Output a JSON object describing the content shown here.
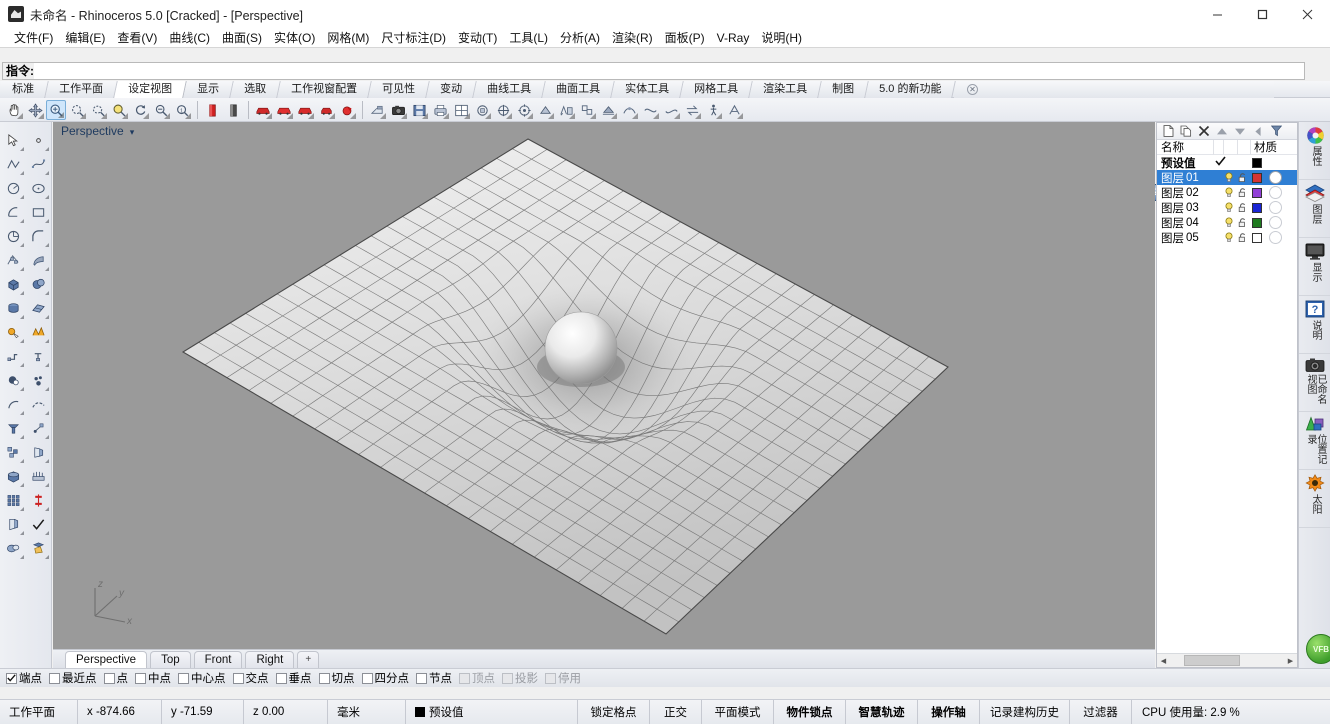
{
  "window": {
    "title": "未命名 - Rhinoceros 5.0 [Cracked] - [Perspective]",
    "app_icon": "rhino-icon",
    "controls": {
      "minimize": "minimize-icon",
      "maximize": "maximize-icon",
      "close": "close-icon"
    }
  },
  "menubar": [
    {
      "label": "文件(F)"
    },
    {
      "label": "编辑(E)"
    },
    {
      "label": "查看(V)"
    },
    {
      "label": "曲线(C)"
    },
    {
      "label": "曲面(S)"
    },
    {
      "label": "实体(O)"
    },
    {
      "label": "网格(M)"
    },
    {
      "label": "尺寸标注(D)"
    },
    {
      "label": "变动(T)"
    },
    {
      "label": "工具(L)"
    },
    {
      "label": "分析(A)"
    },
    {
      "label": "渲染(R)"
    },
    {
      "label": "面板(P)"
    },
    {
      "label": "V-Ray"
    },
    {
      "label": "说明(H)"
    }
  ],
  "command": {
    "prompt": "指令:",
    "value": "",
    "placeholder": ""
  },
  "toolbar_tabs": [
    {
      "label": "标准",
      "active": false
    },
    {
      "label": "工作平面",
      "active": false
    },
    {
      "label": "设定视图",
      "active": true
    },
    {
      "label": "显示",
      "active": false
    },
    {
      "label": "选取",
      "active": false
    },
    {
      "label": "工作视窗配置",
      "active": false
    },
    {
      "label": "可见性",
      "active": false
    },
    {
      "label": "变动",
      "active": false
    },
    {
      "label": "曲线工具",
      "active": false
    },
    {
      "label": "曲面工具",
      "active": false
    },
    {
      "label": "实体工具",
      "active": false
    },
    {
      "label": "网格工具",
      "active": false
    },
    {
      "label": "渲染工具",
      "active": false
    },
    {
      "label": "制图",
      "active": false
    },
    {
      "label": "5.0 的新功能",
      "active": false
    }
  ],
  "viewport": {
    "name": "Perspective",
    "axes": {
      "x": "x",
      "y": "y",
      "z": "z"
    },
    "background_color": "#9a9a9a",
    "tabs": [
      {
        "label": "Perspective",
        "active": true
      },
      {
        "label": "Top",
        "active": false
      },
      {
        "label": "Front",
        "active": false
      },
      {
        "label": "Right",
        "active": false
      },
      {
        "label": "+",
        "active": false
      }
    ]
  },
  "layers_panel": {
    "toolbar_icons": [
      "new-layer-icon",
      "copy-layer-icon",
      "delete-layer-icon",
      "move-up-icon",
      "move-down-icon",
      "back-arrow-icon",
      "filter-icon"
    ],
    "columns": {
      "name": "名称",
      "material": "材质"
    },
    "rows": [
      {
        "name": "预设值",
        "sub": "",
        "current": true,
        "selected": false,
        "color": "#000000",
        "bulb": false,
        "lock": false,
        "material": false
      },
      {
        "name": "图层",
        "sub": "01",
        "current": false,
        "selected": true,
        "color": "#d53434",
        "bulb": true,
        "lock": true,
        "material": true
      },
      {
        "name": "图层",
        "sub": "02",
        "current": false,
        "selected": false,
        "color": "#9140d6",
        "bulb": true,
        "lock": true,
        "material": false
      },
      {
        "name": "图层",
        "sub": "03",
        "current": false,
        "selected": false,
        "color": "#1a25d4",
        "bulb": true,
        "lock": true,
        "material": false
      },
      {
        "name": "图层",
        "sub": "04",
        "current": false,
        "selected": false,
        "color": "#1f7a1f",
        "bulb": true,
        "lock": true,
        "material": false
      },
      {
        "name": "图层",
        "sub": "05",
        "current": false,
        "selected": false,
        "color": "#ffffff",
        "bulb": true,
        "lock": true,
        "material": false
      }
    ]
  },
  "sidebar_tabs": [
    {
      "label": "属性",
      "icon": "color-wheel-icon"
    },
    {
      "label": "图层",
      "icon": "layers-icon"
    },
    {
      "label": "显示",
      "icon": "monitor-icon"
    },
    {
      "label": "说明",
      "icon": "help-icon"
    },
    {
      "label": "已命名视图",
      "icon": "camera-icon"
    },
    {
      "label": "位置记录",
      "icon": "position-icon"
    },
    {
      "label": "太阳",
      "icon": "sun-icon"
    }
  ],
  "osnap": [
    {
      "label": "端点",
      "checked": true,
      "enabled": true
    },
    {
      "label": "最近点",
      "checked": false,
      "enabled": true
    },
    {
      "label": "点",
      "checked": false,
      "enabled": true
    },
    {
      "label": "中点",
      "checked": false,
      "enabled": true
    },
    {
      "label": "中心点",
      "checked": false,
      "enabled": true
    },
    {
      "label": "交点",
      "checked": false,
      "enabled": true
    },
    {
      "label": "垂点",
      "checked": false,
      "enabled": true
    },
    {
      "label": "切点",
      "checked": false,
      "enabled": true
    },
    {
      "label": "四分点",
      "checked": false,
      "enabled": true
    },
    {
      "label": "节点",
      "checked": false,
      "enabled": true
    },
    {
      "label": "顶点",
      "checked": false,
      "enabled": false
    },
    {
      "label": "投影",
      "checked": false,
      "enabled": false
    },
    {
      "label": "停用",
      "checked": false,
      "enabled": false
    }
  ],
  "statusbar": {
    "cplane": "工作平面",
    "x": "x -874.66",
    "y": "y -71.59",
    "z": "z 0.00",
    "units": "毫米",
    "layer_swatch": "#000000",
    "layer": "预设值",
    "toggles": [
      {
        "label": "锁定格点",
        "bold": false
      },
      {
        "label": "正交",
        "bold": false
      },
      {
        "label": "平面模式",
        "bold": false
      },
      {
        "label": "物件锁点",
        "bold": true
      },
      {
        "label": "智慧轨迹",
        "bold": true
      },
      {
        "label": "操作轴",
        "bold": true
      },
      {
        "label": "记录建构历史",
        "bold": false
      },
      {
        "label": "过滤器",
        "bold": false
      }
    ],
    "cpu": "CPU 使用量: 2.9 %"
  }
}
